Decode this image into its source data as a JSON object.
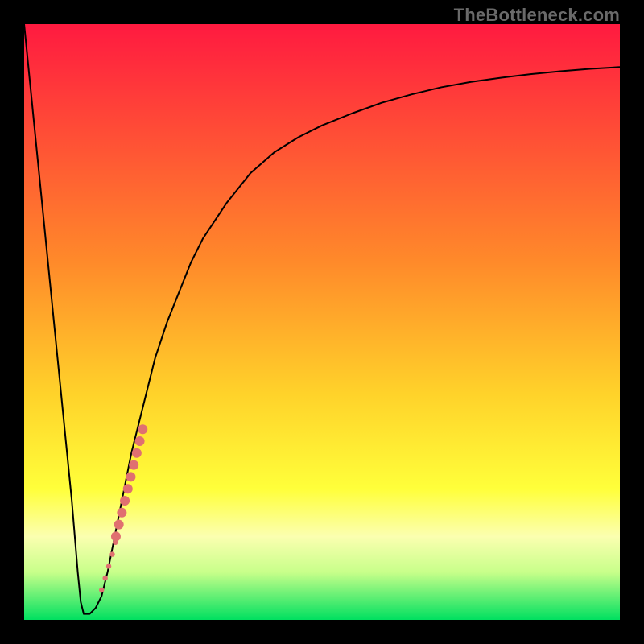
{
  "watermark": "TheBottleneck.com",
  "chart_data": {
    "type": "line",
    "title": "",
    "xlabel": "",
    "ylabel": "",
    "xlim": [
      0,
      100
    ],
    "ylim": [
      0,
      100
    ],
    "gradient_direction": "vertical",
    "gradient_stops": [
      {
        "pos": 0,
        "color": "#ff1a40"
      },
      {
        "pos": 40,
        "color": "#ff8a2a"
      },
      {
        "pos": 62,
        "color": "#ffd22a"
      },
      {
        "pos": 78,
        "color": "#ffff3a"
      },
      {
        "pos": 86,
        "color": "#fbffb0"
      },
      {
        "pos": 92,
        "color": "#c8ff8a"
      },
      {
        "pos": 100,
        "color": "#00e060"
      }
    ],
    "series": [
      {
        "name": "bottleneck-curve",
        "color": "#000000",
        "stroke_width": 2,
        "x": [
          0,
          1,
          2,
          3,
          4,
          5,
          6,
          7,
          8,
          9,
          9.5,
          10,
          10.5,
          11,
          12,
          13,
          14,
          15,
          16,
          18,
          20,
          22,
          24,
          26,
          28,
          30,
          34,
          38,
          42,
          46,
          50,
          55,
          60,
          65,
          70,
          75,
          80,
          85,
          90,
          95,
          100
        ],
        "y": [
          100,
          90,
          80,
          70,
          60,
          50,
          40,
          30,
          20,
          8,
          3,
          1,
          1,
          1,
          2,
          4,
          8,
          13,
          18,
          28,
          36,
          44,
          50,
          55,
          60,
          64,
          70,
          75,
          78.5,
          81,
          83,
          85,
          86.8,
          88.2,
          89.4,
          90.3,
          91,
          91.6,
          92.1,
          92.5,
          92.8
        ]
      }
    ],
    "scatter": {
      "name": "sample-points",
      "color": "#e07070",
      "radius_small": 3.2,
      "radius_large": 6,
      "points": [
        {
          "x": 13.0,
          "y": 5,
          "r": "small"
        },
        {
          "x": 13.6,
          "y": 7,
          "r": "small"
        },
        {
          "x": 14.2,
          "y": 9,
          "r": "small"
        },
        {
          "x": 14.8,
          "y": 11,
          "r": "small"
        },
        {
          "x": 15.3,
          "y": 13,
          "r": "small"
        },
        {
          "x": 15.4,
          "y": 14,
          "r": "large"
        },
        {
          "x": 15.9,
          "y": 16,
          "r": "large"
        },
        {
          "x": 16.4,
          "y": 18,
          "r": "large"
        },
        {
          "x": 16.9,
          "y": 20,
          "r": "large"
        },
        {
          "x": 17.4,
          "y": 22,
          "r": "large"
        },
        {
          "x": 17.9,
          "y": 24,
          "r": "large"
        },
        {
          "x": 18.4,
          "y": 26,
          "r": "large"
        },
        {
          "x": 18.9,
          "y": 28,
          "r": "large"
        },
        {
          "x": 19.4,
          "y": 30,
          "r": "large"
        },
        {
          "x": 19.9,
          "y": 32,
          "r": "large"
        }
      ]
    }
  }
}
